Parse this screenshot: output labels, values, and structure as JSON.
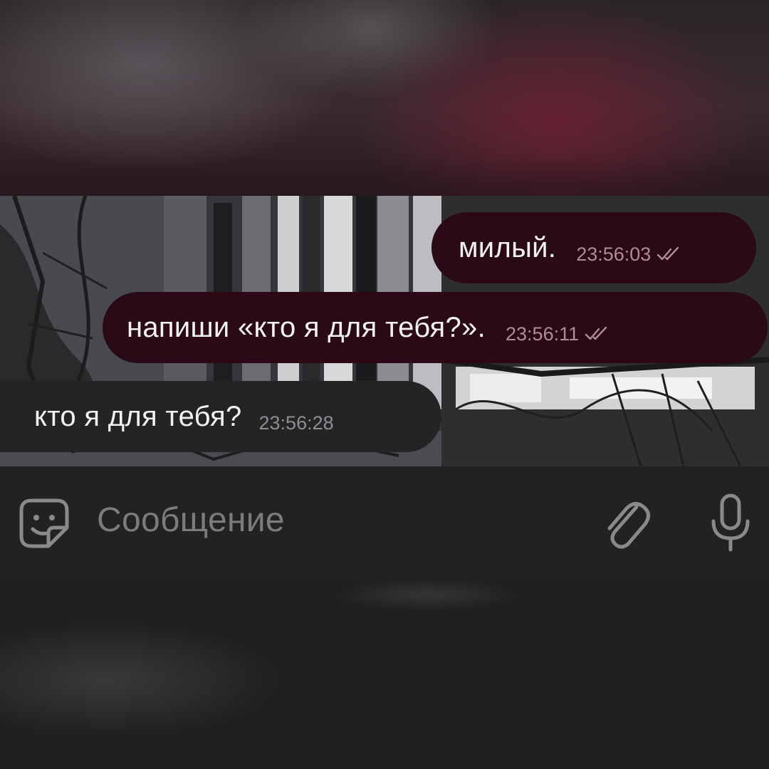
{
  "chat": {
    "messages": [
      {
        "direction": "outgoing",
        "text": "милый.",
        "time": "23:56:03",
        "status": "read-double-check-icon"
      },
      {
        "direction": "outgoing",
        "text": "напиши «кто я для тебя?».",
        "time": "23:56:11",
        "status": "read-double-check-icon"
      },
      {
        "direction": "incoming",
        "text": "кто я для тебя?",
        "time": "23:56:28"
      }
    ]
  },
  "composer": {
    "placeholder": "Сообщение",
    "icons": [
      "sticker-emoji-icon",
      "paperclip-icon",
      "microphone-icon"
    ]
  },
  "colors": {
    "outgoing_bubble": "#2b0a18",
    "incoming_bubble": "#242426",
    "outgoing_time": "#b28a9a",
    "input_bar": "#222222"
  }
}
